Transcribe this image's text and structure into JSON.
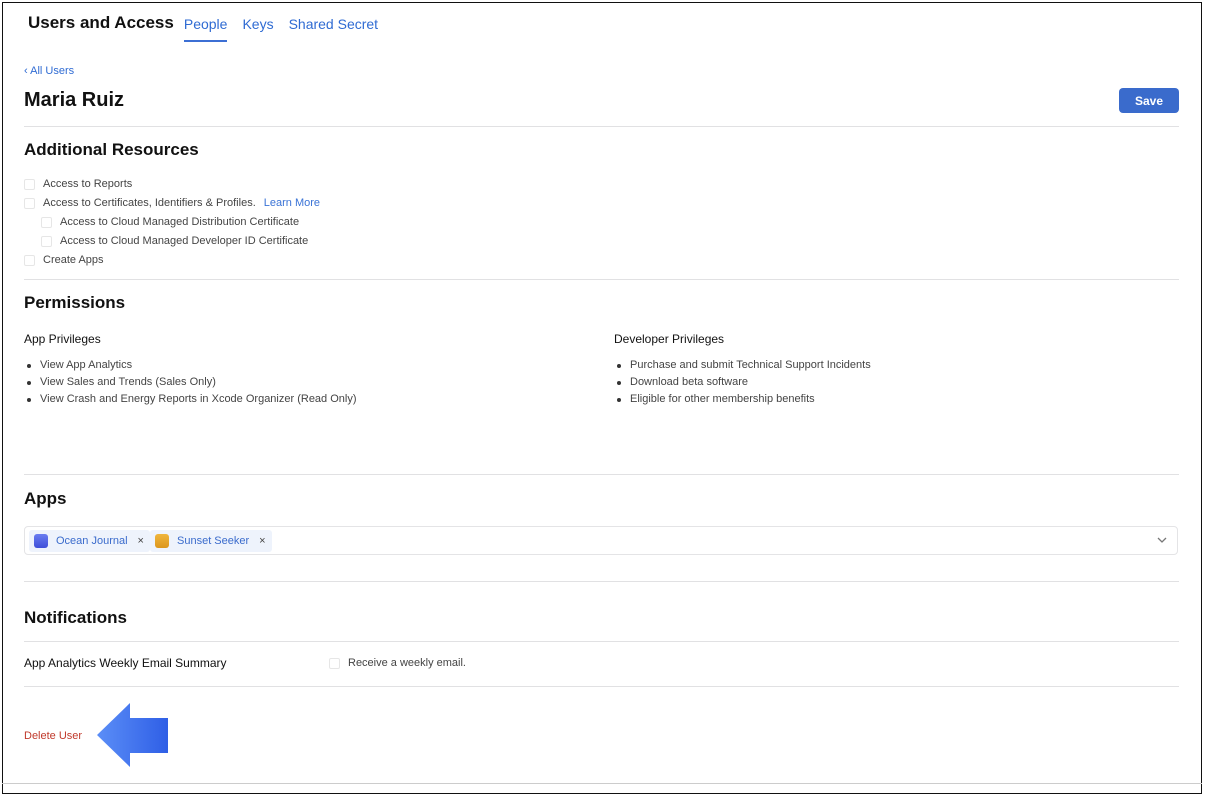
{
  "header": {
    "title": "Users and Access",
    "tabs": [
      {
        "label": "People",
        "active": true
      },
      {
        "label": "Keys",
        "active": false
      },
      {
        "label": "Shared Secret",
        "active": false
      }
    ]
  },
  "breadcrumb": {
    "back_label": "All Users"
  },
  "user": {
    "name": "Maria Ruiz"
  },
  "toolbar": {
    "save_label": "Save"
  },
  "additional_resources": {
    "title": "Additional Resources",
    "items": [
      {
        "label": "Access to Reports",
        "checked": false,
        "indent": false
      },
      {
        "label": "Access to Certificates, Identifiers & Profiles.",
        "checked": false,
        "indent": false,
        "link": "Learn More"
      },
      {
        "label": "Access to Cloud Managed Distribution Certificate",
        "checked": false,
        "indent": true
      },
      {
        "label": "Access to Cloud Managed Developer ID Certificate",
        "checked": false,
        "indent": true
      },
      {
        "label": "Create Apps",
        "checked": false,
        "indent": false
      }
    ]
  },
  "permissions": {
    "title": "Permissions",
    "app_privileges": {
      "title": "App Privileges",
      "items": [
        "View App Analytics",
        "View Sales and Trends (Sales Only)",
        "View Crash and Energy Reports in Xcode Organizer (Read Only)"
      ]
    },
    "developer_privileges": {
      "title": "Developer Privileges",
      "items": [
        "Purchase and submit Technical Support Incidents",
        "Download beta software",
        "Eligible for other membership benefits"
      ]
    }
  },
  "apps": {
    "title": "Apps",
    "selected": [
      {
        "name": "Ocean Journal",
        "color": "#4f63e8"
      },
      {
        "name": "Sunset Seeker",
        "color": "#e7a92a"
      }
    ]
  },
  "notifications": {
    "title": "Notifications",
    "row_label": "App Analytics Weekly Email Summary",
    "checkbox_label": "Receive a weekly email.",
    "checked": false
  },
  "actions": {
    "delete_label": "Delete User"
  },
  "colors": {
    "accent": "#3a6bcc",
    "danger": "#c0392b",
    "annotation_arrow": "#3d6ef0"
  }
}
